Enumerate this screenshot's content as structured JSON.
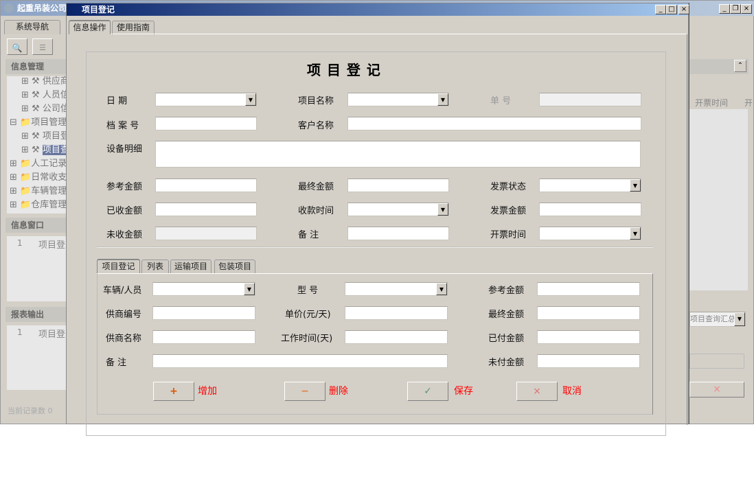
{
  "bg_app": {
    "title": "起重吊装公司",
    "nav_tab": "系统导航",
    "info_header": "信息管理",
    "tree": [
      "供应商",
      "人员信",
      "公司信",
      "项目管理",
      "项目登",
      "项目查",
      "人工记录",
      "日常收支",
      "车辆管理",
      "仓库管理"
    ],
    "info_window": "信息窗口",
    "info_row_num": "1",
    "info_row_text": "项目登",
    "report_header": "报表输出",
    "report_row_num": "1",
    "report_row_text": "项目登",
    "status": "当前记录数 0",
    "column_header": "开票时间",
    "column_header2": "开",
    "report_select": "项目查询汇总"
  },
  "dialog": {
    "title": "项目登记",
    "tabs": [
      "信息操作",
      "使用指南"
    ],
    "heading": "项 目 登 记",
    "fields": {
      "date": "日 期",
      "project_name": "项目名称",
      "order_no": "单 号",
      "archive_no": "档 案 号",
      "customer": "客户名称",
      "equipment": "设备明细",
      "ref_amount": "参考金额",
      "final_amount": "最终金额",
      "invoice_status": "发票状态",
      "received": "已收金额",
      "receive_time": "收款时间",
      "invoice_amount": "发票金额",
      "unreceived": "未收金额",
      "remark": "备 注",
      "invoice_time": "开票时间"
    },
    "sub_tabs": [
      "项目登记",
      "列表",
      "运输项目",
      "包装项目"
    ],
    "sub_fields": {
      "vehicle": "车辆/人员",
      "model": "型 号",
      "ref_amount": "参考金额",
      "supplier_no": "供商编号",
      "unit_price": "单价(元/天)",
      "final_amount": "最终金额",
      "supplier_name": "供商名称",
      "work_time": "工作时间(天)",
      "paid": "已付金额",
      "remark": "备 注",
      "unpaid": "未付金额"
    },
    "buttons": {
      "add": "增加",
      "delete": "删除",
      "save": "保存",
      "cancel": "取消"
    },
    "window_controls": {
      "minimize": "_",
      "maximize": "□",
      "close": "×"
    }
  },
  "colors": {
    "title_bar": "#0a246a",
    "action_label": "#ff0000"
  }
}
